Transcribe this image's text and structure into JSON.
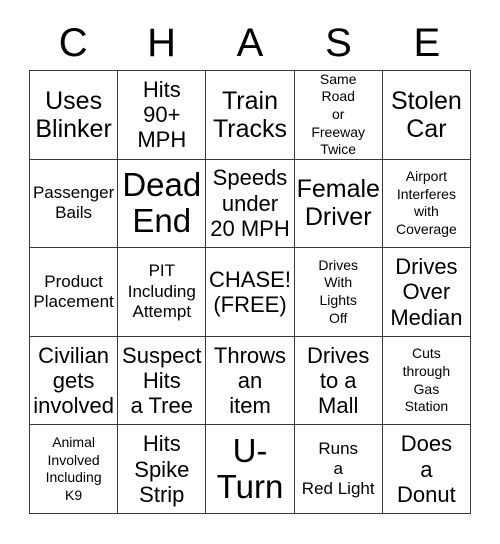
{
  "header": {
    "letters": [
      "C",
      "H",
      "A",
      "S",
      "E"
    ]
  },
  "grid": {
    "columns": 5,
    "rows": 5,
    "border_color": "#3a3a3a",
    "background_color": "#ffffff",
    "text_color": "#000000",
    "cells": [
      {
        "text": "Uses\nBlinker",
        "size": "lg"
      },
      {
        "text": "Hits\n90+\nMPH",
        "size": "md"
      },
      {
        "text": "Train\nTracks",
        "size": "lg"
      },
      {
        "text": "Same\nRoad\nor\nFreeway\nTwice",
        "size": "xs"
      },
      {
        "text": "Stolen\nCar",
        "size": "lg"
      },
      {
        "text": "Passenger\nBails",
        "size": "sm"
      },
      {
        "text": "Dead\nEnd",
        "size": "xl"
      },
      {
        "text": "Speeds\nunder\n20 MPH",
        "size": "md"
      },
      {
        "text": "Female\nDriver",
        "size": "lg"
      },
      {
        "text": "Airport\nInterferes\nwith\nCoverage",
        "size": "xs"
      },
      {
        "text": "Product\nPlacement",
        "size": "sm"
      },
      {
        "text": "PIT\nIncluding\nAttempt",
        "size": "sm"
      },
      {
        "text": "CHASE!\n(FREE)",
        "size": "md"
      },
      {
        "text": "Drives\nWith\nLights\nOff",
        "size": "xs"
      },
      {
        "text": "Drives\nOver\nMedian",
        "size": "md"
      },
      {
        "text": "Civilian\ngets\ninvolved",
        "size": "md"
      },
      {
        "text": "Suspect\nHits\na Tree",
        "size": "md"
      },
      {
        "text": "Throws\nan\nitem",
        "size": "md"
      },
      {
        "text": "Drives\nto a\nMall",
        "size": "md"
      },
      {
        "text": "Cuts\nthrough\nGas\nStation",
        "size": "xs"
      },
      {
        "text": "Animal\nInvolved\nIncluding\nK9",
        "size": "xs"
      },
      {
        "text": "Hits\nSpike\nStrip",
        "size": "md"
      },
      {
        "text": "U-\nTurn",
        "size": "xl"
      },
      {
        "text": "Runs\na\nRed Light",
        "size": "sm"
      },
      {
        "text": "Does\na\nDonut",
        "size": "md"
      }
    ]
  }
}
